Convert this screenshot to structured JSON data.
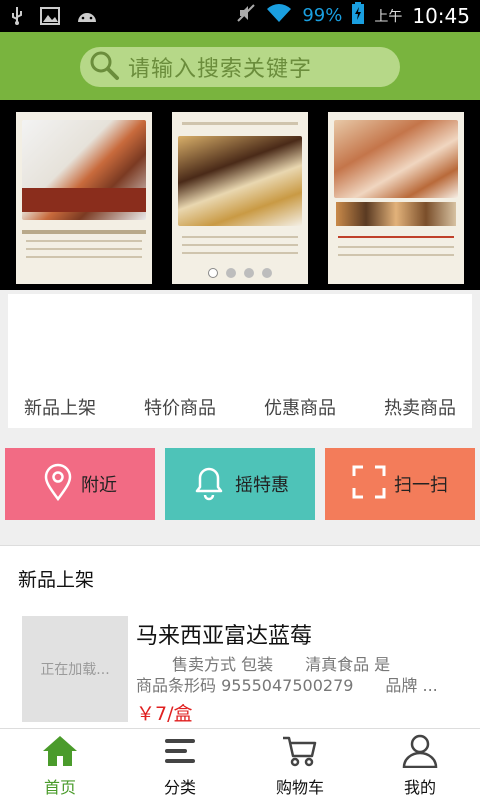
{
  "statusbar": {
    "battery": "99%",
    "ampm": "上午",
    "time": "10:45"
  },
  "search": {
    "placeholder": "请输入搜索关键字"
  },
  "banner": {
    "dots": 4,
    "active_dot": 0
  },
  "categories": [
    "新品上架",
    "特价商品",
    "优惠商品",
    "热卖商品"
  ],
  "quick_tiles": [
    {
      "label": "附近",
      "icon": "location-pin-icon",
      "color": "#f26b84"
    },
    {
      "label": "摇特惠",
      "icon": "bell-icon",
      "color": "#4ec3b8"
    },
    {
      "label": "扫一扫",
      "icon": "scan-icon",
      "color": "#f37c5a"
    }
  ],
  "section": {
    "title": "新品上架"
  },
  "product": {
    "thumb_text": "正在加载...",
    "title": "马来西亚富达蓝莓",
    "line1": "售卖方式 包装　　清真食品 是",
    "line2": "商品条形码 9555047500279　　品牌 ...",
    "price": "￥7/盒"
  },
  "bottom_nav": {
    "home": "首页",
    "category": "分类",
    "cart": "购物车",
    "mine": "我的",
    "accent": "#4a9b2b"
  }
}
